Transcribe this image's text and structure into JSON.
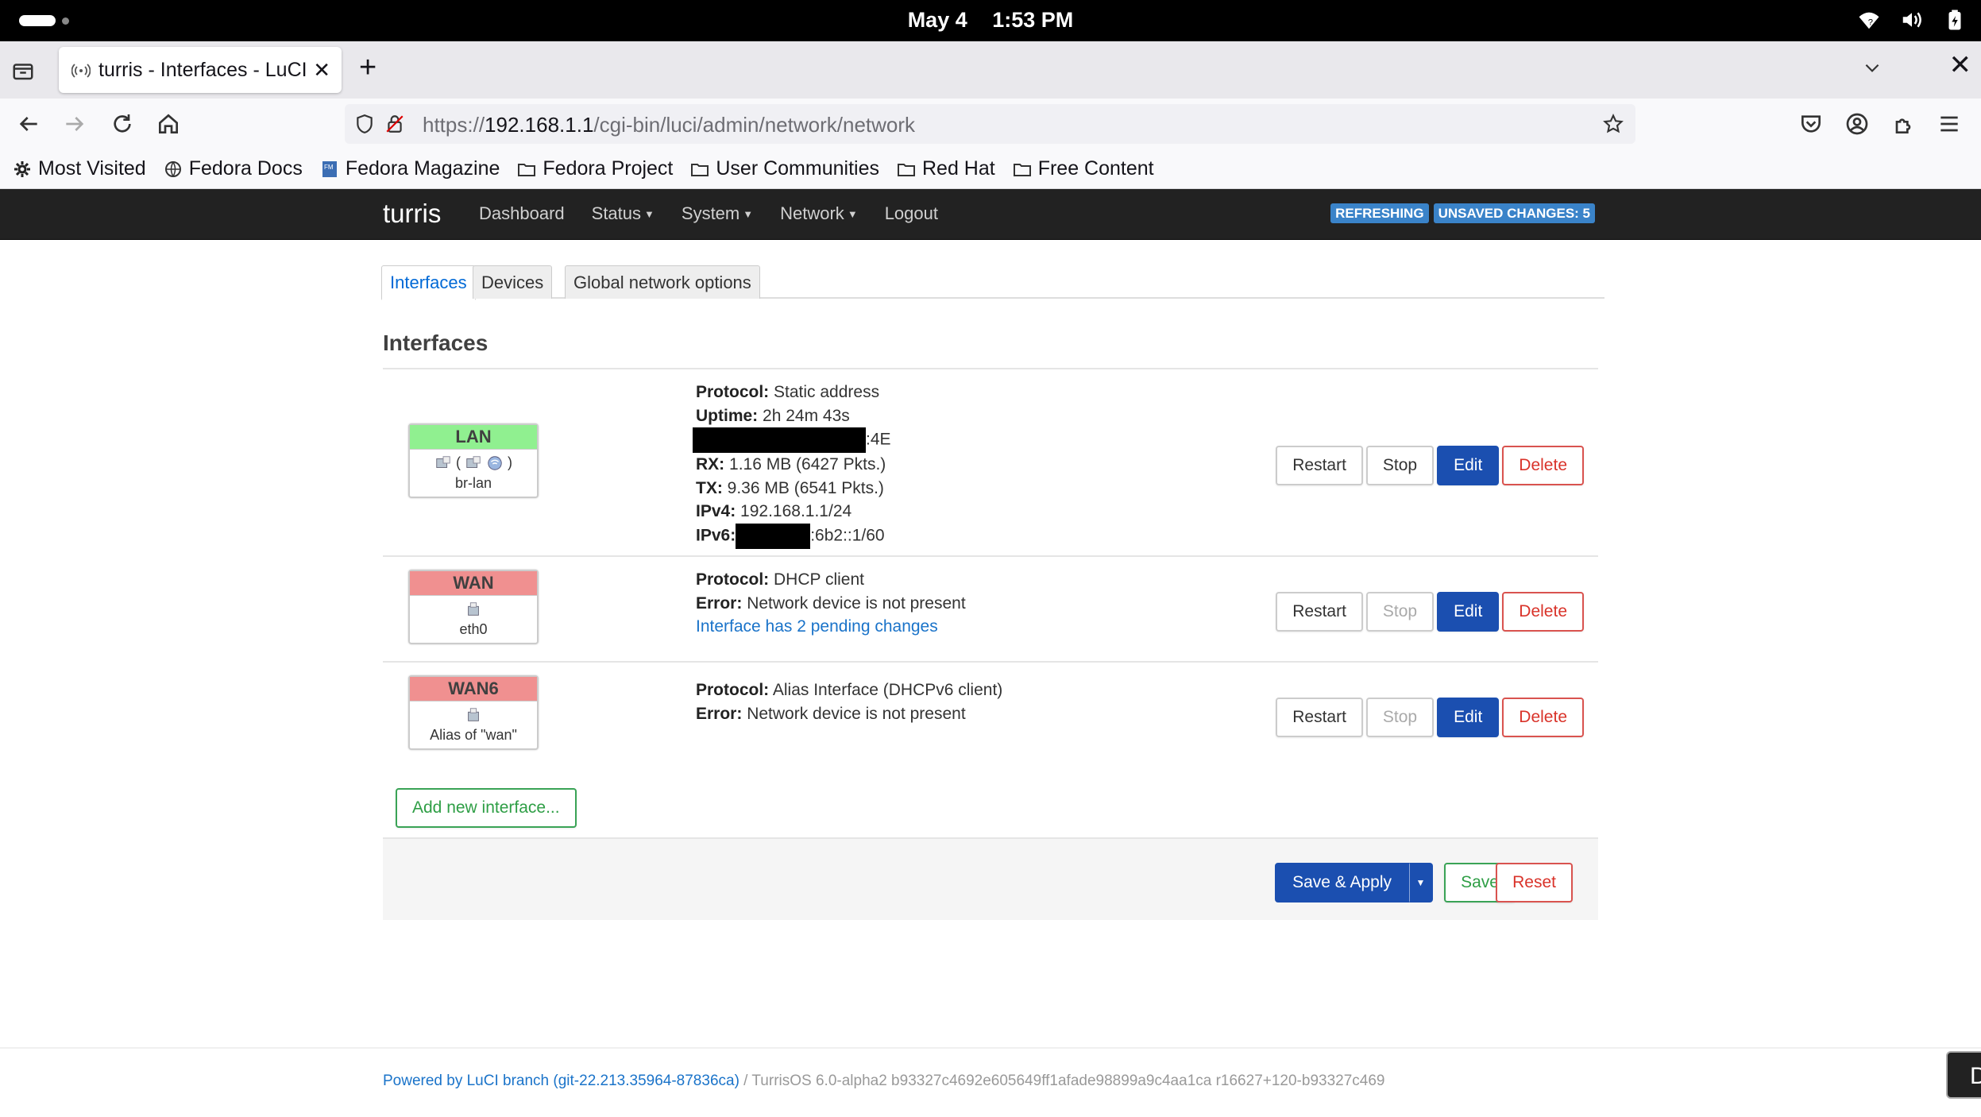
{
  "system": {
    "date": "May 4",
    "time": "1:53 PM"
  },
  "browser": {
    "tab_title": "turris - Interfaces - LuCI",
    "url_host": "https://192.168.1.1",
    "url_prefix": "https://",
    "url_domain": "192.168.1.1",
    "url_path": "/cgi-bin/luci/admin/network/network",
    "bookmarks": [
      "Most Visited",
      "Fedora Docs",
      "Fedora Magazine",
      "Fedora Project",
      "User Communities",
      "Red Hat",
      "Free Content"
    ]
  },
  "luci": {
    "brand": "turris",
    "menu": {
      "dashboard": "Dashboard",
      "status": "Status",
      "system": "System",
      "network": "Network",
      "logout": "Logout"
    },
    "indicators": {
      "refreshing": "REFRESHING",
      "unsaved": "UNSAVED CHANGES: 5"
    },
    "tabs": [
      "Interfaces",
      "Devices",
      "Global network options"
    ],
    "section_title": "Interfaces",
    "interfaces": [
      {
        "name": "LAN",
        "color": "#90f090",
        "device": "br-lan",
        "device_icons": "( )",
        "protocol_label": "Protocol:",
        "protocol": "Static address",
        "uptime_label": "Uptime:",
        "uptime": "2h 24m 43s",
        "mac_suffix": ":4E",
        "rx_label": "RX:",
        "rx": "1.16 MB (6427 Pkts.)",
        "tx_label": "TX:",
        "tx": "9.36 MB (6541 Pkts.)",
        "ipv4_label": "IPv4:",
        "ipv4": "192.168.1.1/24",
        "ipv6_label": "IPv6:",
        "ipv6_suffix": ":6b2::1/60"
      },
      {
        "name": "WAN",
        "color": "#f09090",
        "device": "eth0",
        "protocol_label": "Protocol:",
        "protocol": "DHCP client",
        "error_label": "Error:",
        "error": "Network device is not present",
        "pending": "Interface has 2 pending changes"
      },
      {
        "name": "WAN6",
        "color": "#f09090",
        "device": "Alias of \"wan\"",
        "protocol_label": "Protocol:",
        "protocol": "Alias Interface (DHCPv6 client)",
        "error_label": "Error:",
        "error": "Network device is not present"
      }
    ],
    "buttons": {
      "restart": "Restart",
      "stop": "Stop",
      "edit": "Edit",
      "delete": "Delete",
      "add_interface": "Add new interface...",
      "save_apply": "Save & Apply",
      "save": "Save",
      "reset": "Reset"
    },
    "footer": {
      "powered": "Powered by LuCI branch (git-22.213.35964-87836ca)",
      "separator": " / ",
      "version": "TurrisOS 6.0-alpha2 b93327c4692e605649ff1afade98899a9c4aa1ca r16627+120-b93327c469"
    },
    "corner_button": "D"
  }
}
